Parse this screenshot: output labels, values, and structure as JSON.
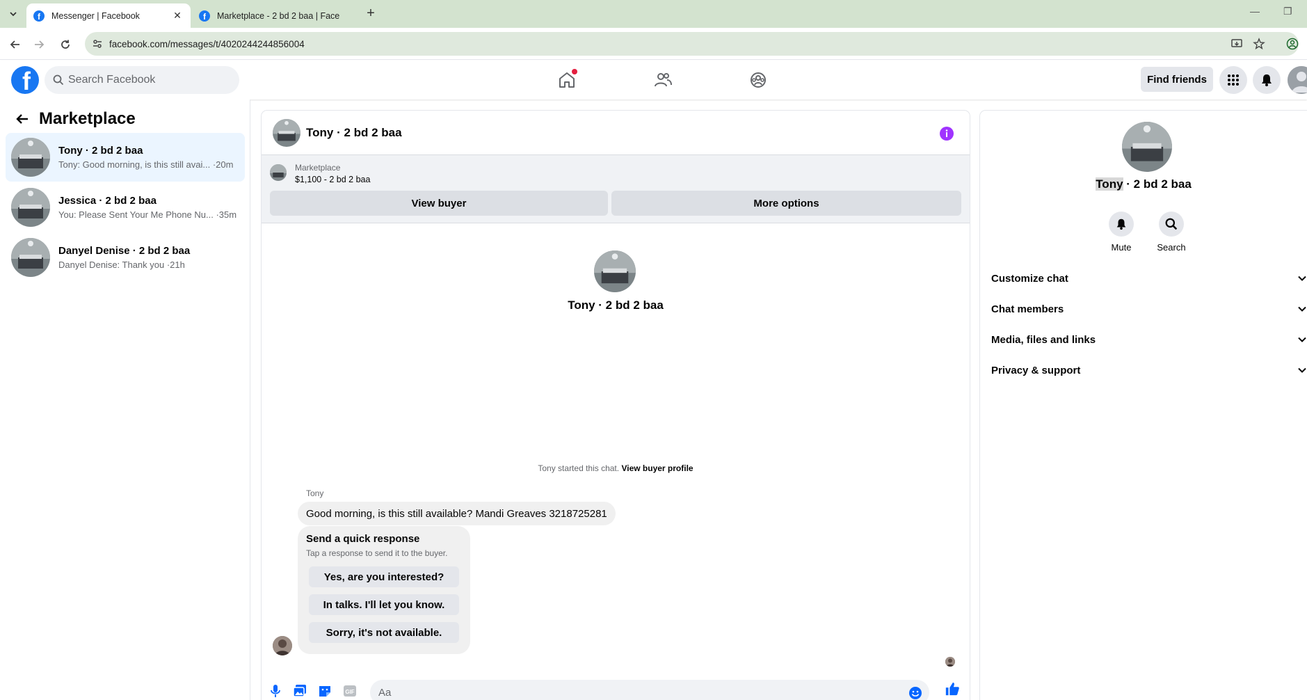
{
  "browser": {
    "tabs": [
      {
        "title": "Messenger | Facebook",
        "active": true
      },
      {
        "title": "Marketplace - 2 bd 2 baa | Face",
        "active": false
      }
    ],
    "url": "facebook.com/messages/t/4020244244856004"
  },
  "header": {
    "search_placeholder": "Search Facebook",
    "find_friends_label": "Find friends",
    "brand_color": "#1877f2"
  },
  "sidebar": {
    "title": "Marketplace",
    "conversations": [
      {
        "name": "Tony · 2 bd 2 baa",
        "preview": "Tony: Good morning, is this still avai... ·20m",
        "selected": true
      },
      {
        "name": "Jessica · 2 bd 2 baa",
        "preview": "You: Please Sent Your Me Phone Nu... ·35m",
        "selected": false
      },
      {
        "name": "Danyel Denise · 2 bd 2 baa",
        "preview": "Danyel Denise: Thank you ·21h",
        "selected": false
      }
    ]
  },
  "chat": {
    "title": "Tony · 2 bd 2 baa",
    "listing": {
      "source": "Marketplace",
      "summary": "$1,100 - 2 bd 2 baa",
      "view_buyer_label": "View buyer",
      "more_options_label": "More options"
    },
    "intro_name": "Tony · 2 bd 2 baa",
    "started_text": "Tony started this chat.",
    "started_link": "View buyer profile",
    "sender": "Tony",
    "message": "Good morning, is this still available? Mandi Greaves 3218725281",
    "quick_response": {
      "title": "Send a quick response",
      "subtitle": "Tap a response to send it to the buyer.",
      "options": [
        "Yes, are you interested?",
        "In talks. I'll let you know.",
        "Sorry, it's not available."
      ]
    },
    "composer_placeholder": "Aa",
    "accent_color": "#a033ff"
  },
  "details": {
    "name_highlight": "Tony",
    "name_rest": " · 2 bd 2 baa",
    "actions": [
      {
        "label": "Mute"
      },
      {
        "label": "Search"
      }
    ],
    "sections": [
      "Customize chat",
      "Chat members",
      "Media, files and links",
      "Privacy & support"
    ]
  }
}
